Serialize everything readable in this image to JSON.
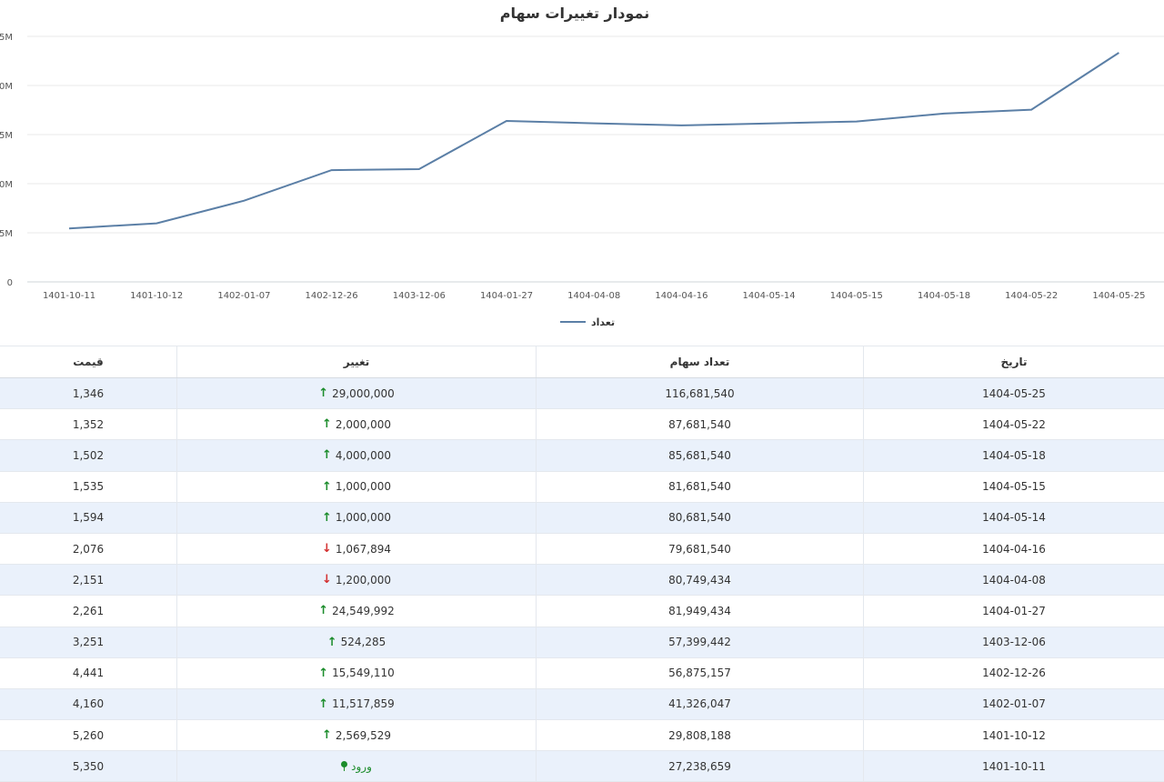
{
  "chart_data": {
    "type": "line",
    "title": "نمودار تغییرات سهام",
    "x": [
      "1401-10-11",
      "1401-10-12",
      "1402-01-07",
      "1402-12-26",
      "1403-12-06",
      "1404-01-27",
      "1404-04-08",
      "1404-04-16",
      "1404-05-14",
      "1404-05-15",
      "1404-05-18",
      "1404-05-22",
      "1404-05-25"
    ],
    "series": [
      {
        "name": "تعداد",
        "color": "#5b7fa6",
        "values": [
          27238659,
          29808188,
          41326047,
          56875157,
          57399442,
          81949434,
          80749434,
          79681540,
          80681540,
          81681540,
          85681540,
          87681540,
          116681540
        ]
      }
    ],
    "y_ticks": [
      "0",
      "5M",
      "0M",
      "5M",
      "0M",
      "5M"
    ],
    "y_tick_values": [
      0,
      25000000,
      50000000,
      75000000,
      100000000,
      125000000
    ],
    "ylim": [
      0,
      125000000
    ],
    "grid": true,
    "legend": "bottom"
  },
  "table": {
    "headers": {
      "date": "تاریخ",
      "shares": "تعداد سهام",
      "change": "تغییر",
      "price": "قیمت"
    },
    "rows": [
      {
        "date": "1404-05-25",
        "shares": "116,681,540",
        "change": "29,000,000",
        "dir": "up",
        "price": "1,346"
      },
      {
        "date": "1404-05-22",
        "shares": "87,681,540",
        "change": "2,000,000",
        "dir": "up",
        "price": "1,352"
      },
      {
        "date": "1404-05-18",
        "shares": "85,681,540",
        "change": "4,000,000",
        "dir": "up",
        "price": "1,502"
      },
      {
        "date": "1404-05-15",
        "shares": "81,681,540",
        "change": "1,000,000",
        "dir": "up",
        "price": "1,535"
      },
      {
        "date": "1404-05-14",
        "shares": "80,681,540",
        "change": "1,000,000",
        "dir": "up",
        "price": "1,594"
      },
      {
        "date": "1404-04-16",
        "shares": "79,681,540",
        "change": "1,067,894",
        "dir": "down",
        "price": "2,076"
      },
      {
        "date": "1404-04-08",
        "shares": "80,749,434",
        "change": "1,200,000",
        "dir": "down",
        "price": "2,151"
      },
      {
        "date": "1404-01-27",
        "shares": "81,949,434",
        "change": "24,549,992",
        "dir": "up",
        "price": "2,261"
      },
      {
        "date": "1403-12-06",
        "shares": "57,399,442",
        "change": "524,285",
        "dir": "up",
        "price": "3,251"
      },
      {
        "date": "1402-12-26",
        "shares": "56,875,157",
        "change": "15,549,110",
        "dir": "up",
        "price": "4,441"
      },
      {
        "date": "1402-01-07",
        "shares": "41,326,047",
        "change": "11,517,859",
        "dir": "up",
        "price": "4,160"
      },
      {
        "date": "1401-10-12",
        "shares": "29,808,188",
        "change": "2,569,529",
        "dir": "up",
        "price": "5,260"
      },
      {
        "date": "1401-10-11",
        "shares": "27,238,659",
        "change": "ورود",
        "dir": "entry",
        "price": "5,350"
      }
    ]
  },
  "colors": {
    "up": "#1b8c2b",
    "down": "#d32f2f",
    "line": "#5b7fa6",
    "alt_row": "#eaf1fb"
  }
}
